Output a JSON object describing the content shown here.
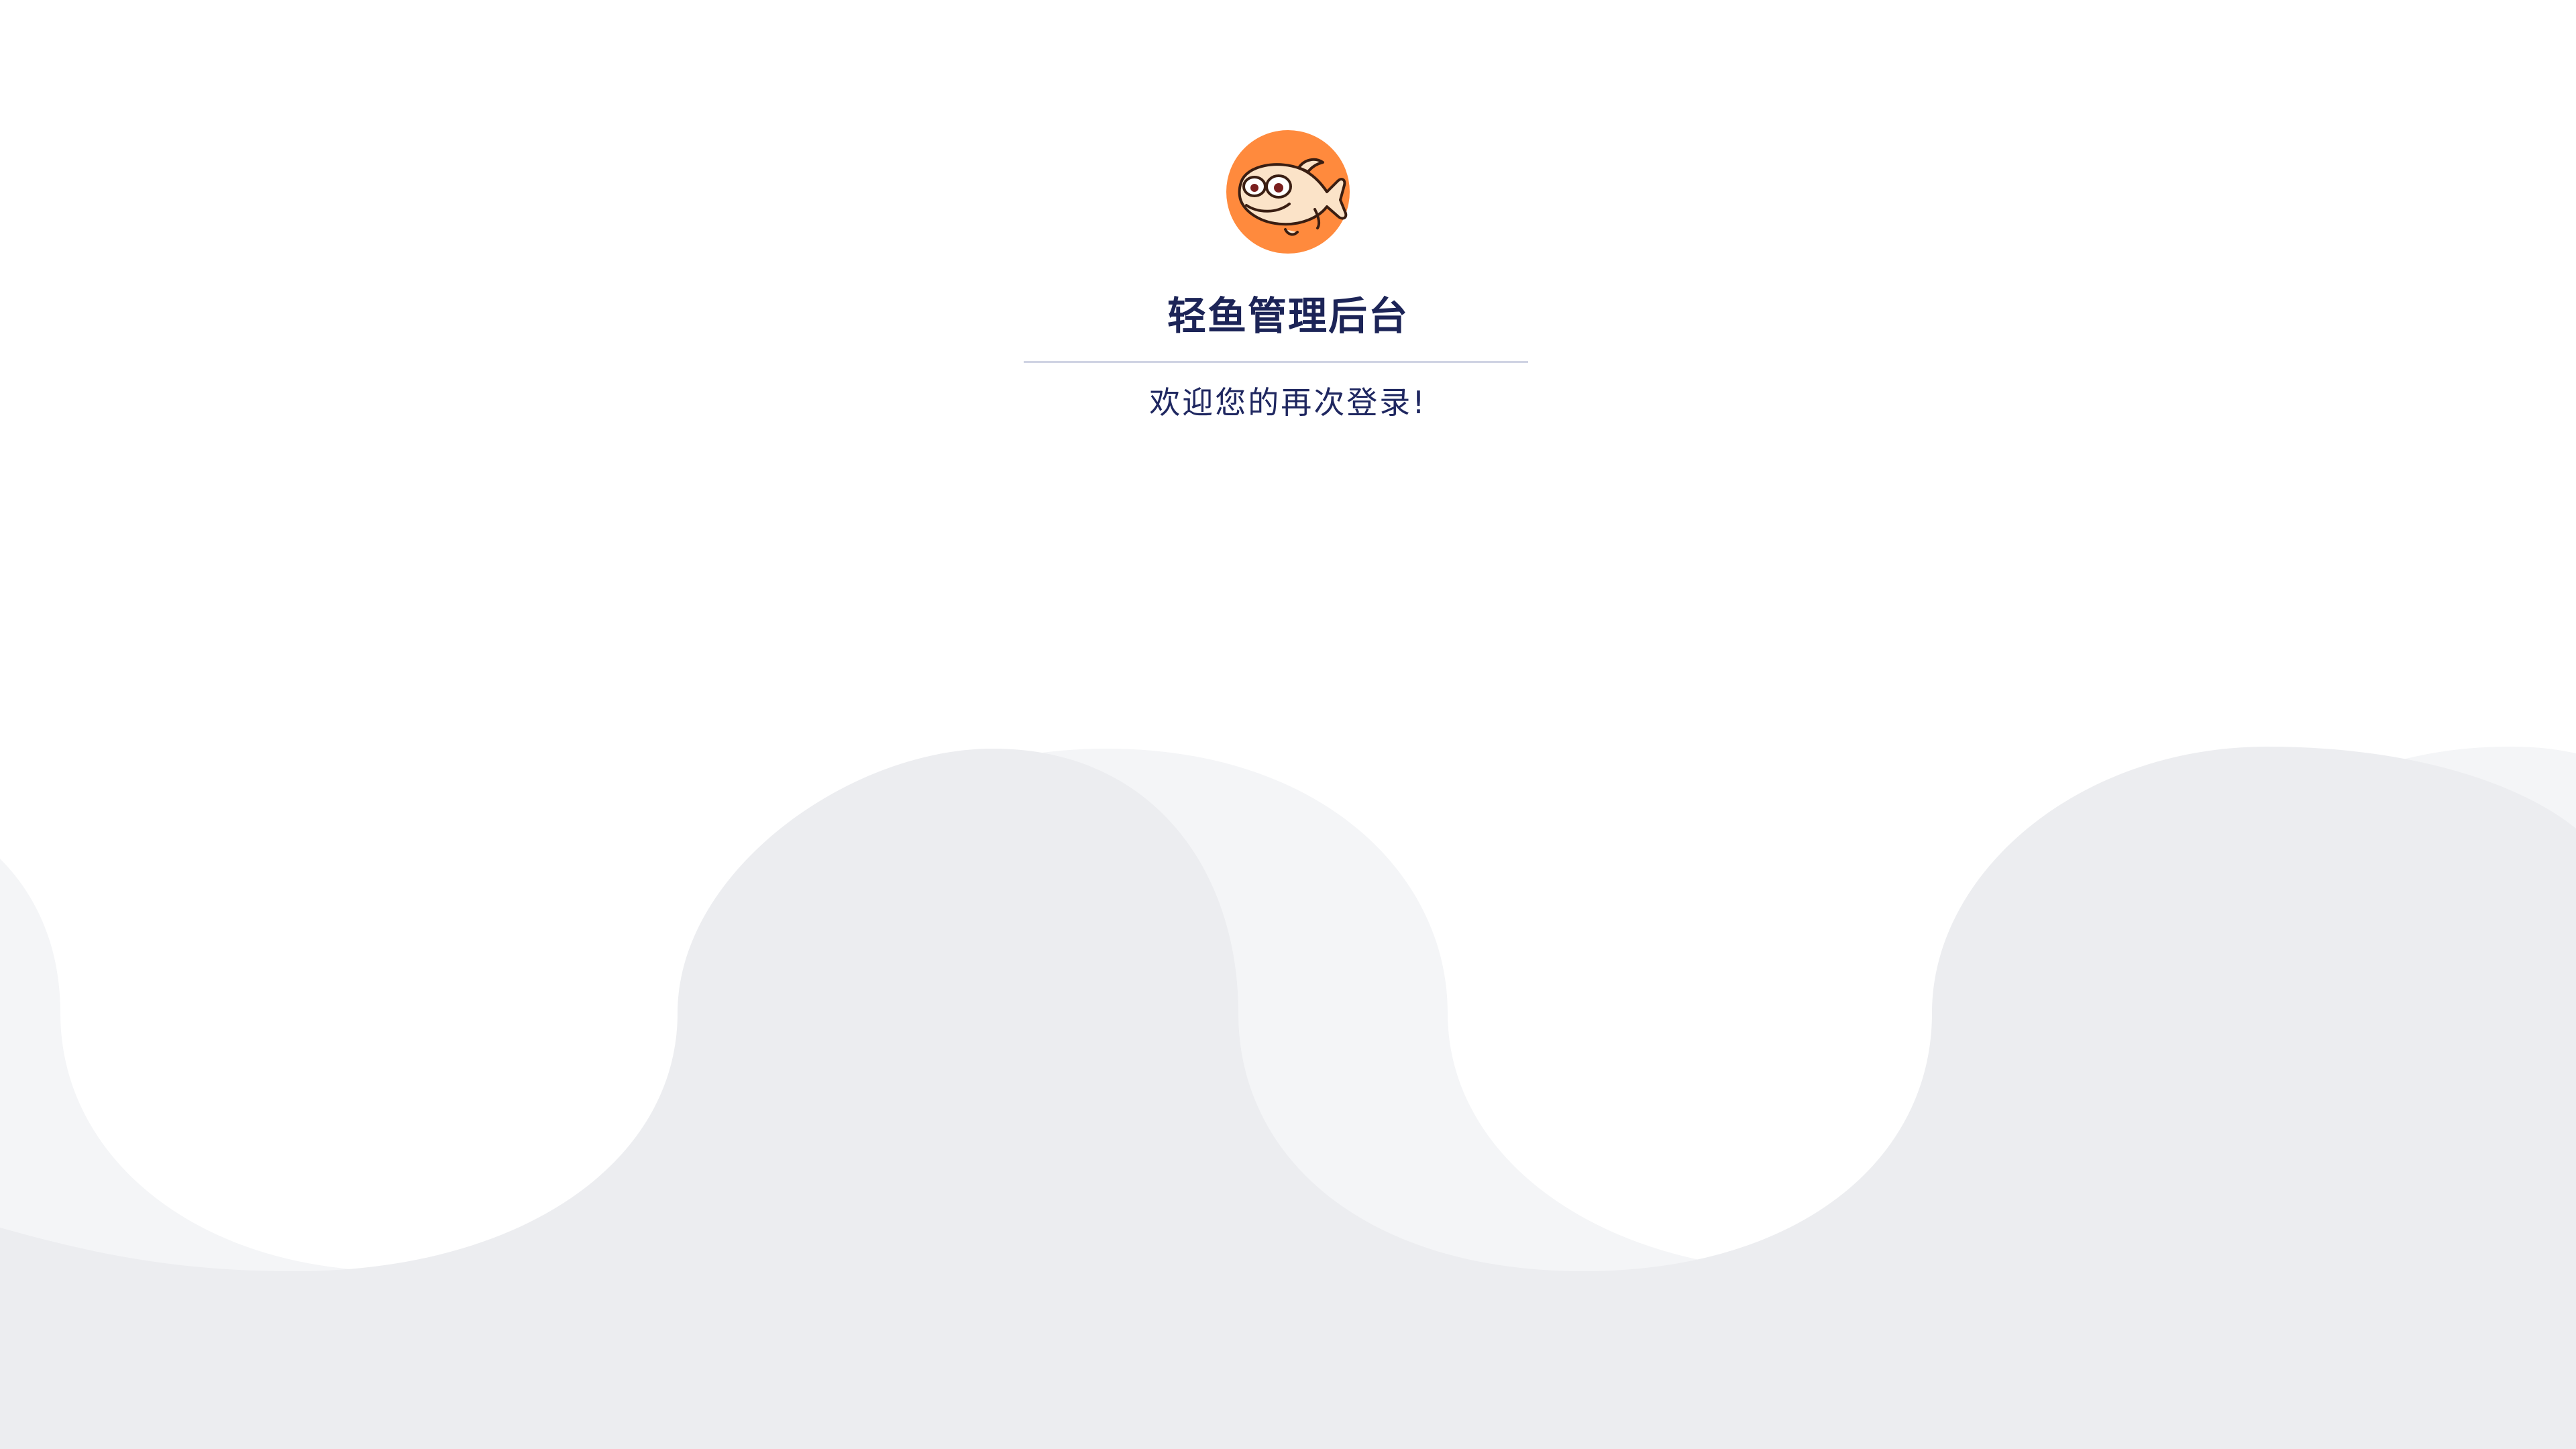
{
  "app": {
    "title": "轻鱼管理后台",
    "subtitle": "欢迎您的再次登录!"
  },
  "logo": {
    "icon": "fish-logo-icon",
    "background_color": "#FF8A3D"
  },
  "theme": {
    "title_color": "#1C2457",
    "subtitle_color": "#1F2760",
    "divider_color": "#CFD3E3",
    "wave_light": "#F4F5F7",
    "wave_mid": "#ECEDF0",
    "background": "#FFFFFF"
  }
}
